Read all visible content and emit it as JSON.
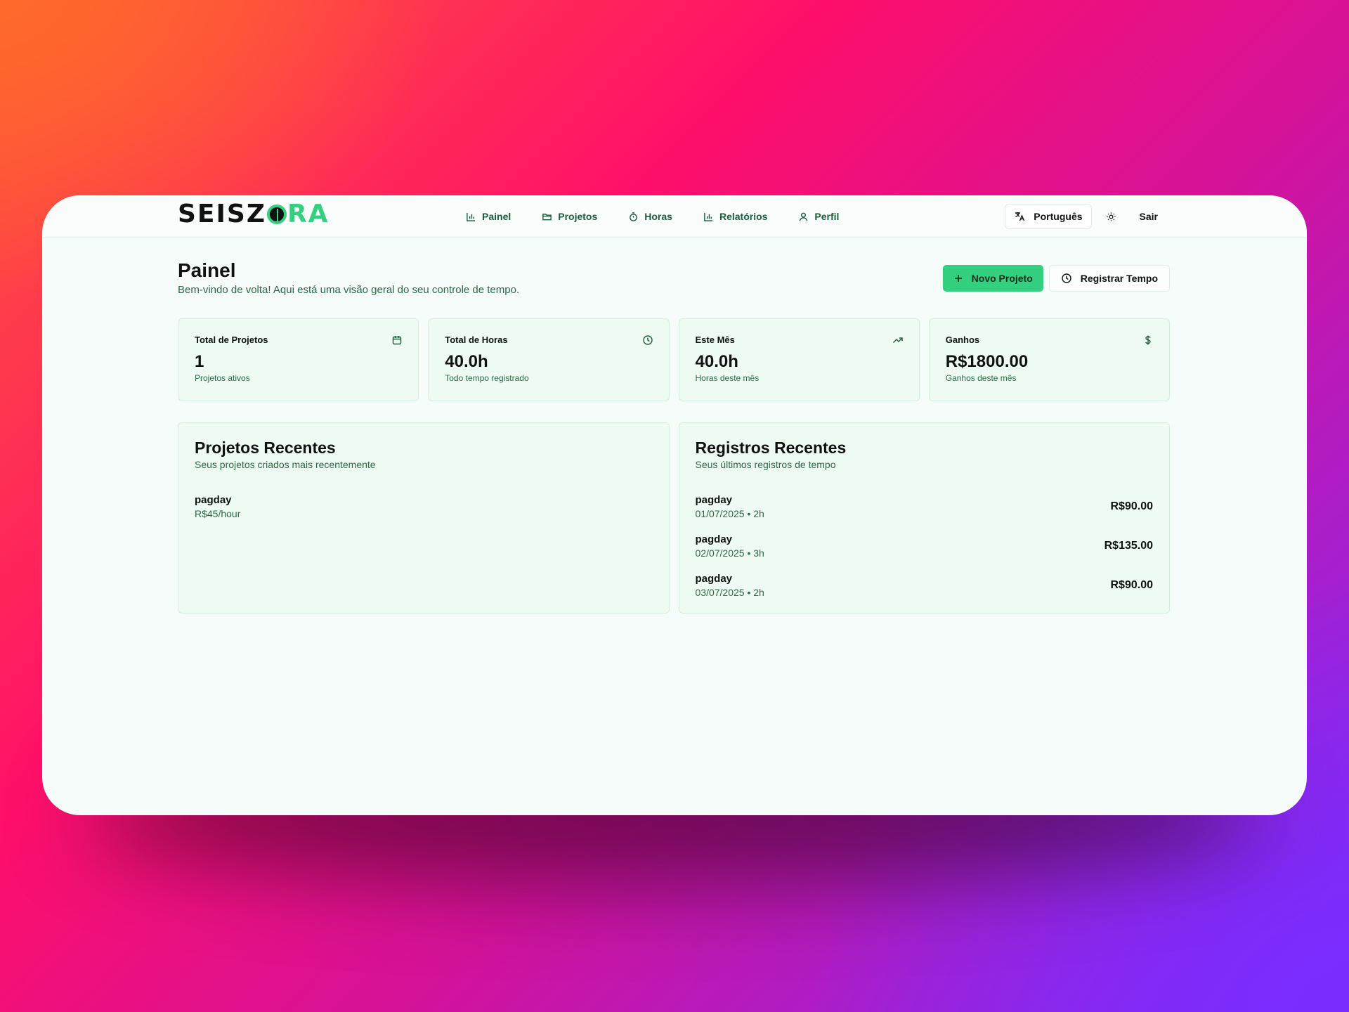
{
  "app": {
    "logo_dark": "SEISZ",
    "logo_green": "RA"
  },
  "nav": {
    "items": [
      {
        "label": "Painel",
        "icon": "bar-chart-icon"
      },
      {
        "label": "Projetos",
        "icon": "folder-icon"
      },
      {
        "label": "Horas",
        "icon": "stopwatch-icon"
      },
      {
        "label": "Relatórios",
        "icon": "bar-chart-icon"
      },
      {
        "label": "Perfil",
        "icon": "user-icon"
      }
    ],
    "language": "Português",
    "logout": "Sair"
  },
  "header": {
    "title": "Painel",
    "subtitle": "Bem-vindo de volta! Aqui está uma visão geral do seu controle de tempo.",
    "new_project": "Novo Projeto",
    "log_time": "Registrar Tempo"
  },
  "stats": [
    {
      "label": "Total de Projetos",
      "value": "1",
      "desc": "Projetos ativos",
      "icon": "calendar-icon"
    },
    {
      "label": "Total de Horas",
      "value": "40.0h",
      "desc": "Todo tempo registrado",
      "icon": "clock-icon"
    },
    {
      "label": "Este Mês",
      "value": "40.0h",
      "desc": "Horas deste mês",
      "icon": "trending-up-icon"
    },
    {
      "label": "Ganhos",
      "value": "R$1800.00",
      "desc": "Ganhos deste mês",
      "icon": "dollar-icon"
    }
  ],
  "recent_projects": {
    "title": "Projetos Recentes",
    "subtitle": "Seus projetos criados mais recentemente",
    "items": [
      {
        "name": "pagday",
        "rate": "R$45/hour"
      }
    ]
  },
  "recent_entries": {
    "title": "Registros Recentes",
    "subtitle": "Seus últimos registros de tempo",
    "items": [
      {
        "name": "pagday",
        "meta": "01/07/2025 • 2h",
        "amount": "R$90.00"
      },
      {
        "name": "pagday",
        "meta": "02/07/2025 • 3h",
        "amount": "R$135.00"
      },
      {
        "name": "pagday",
        "meta": "03/07/2025 • 2h",
        "amount": "R$90.00"
      }
    ]
  },
  "colors": {
    "accent": "#33d07f",
    "text_green": "#2b6a44",
    "card_bg": "#edfbf2"
  }
}
